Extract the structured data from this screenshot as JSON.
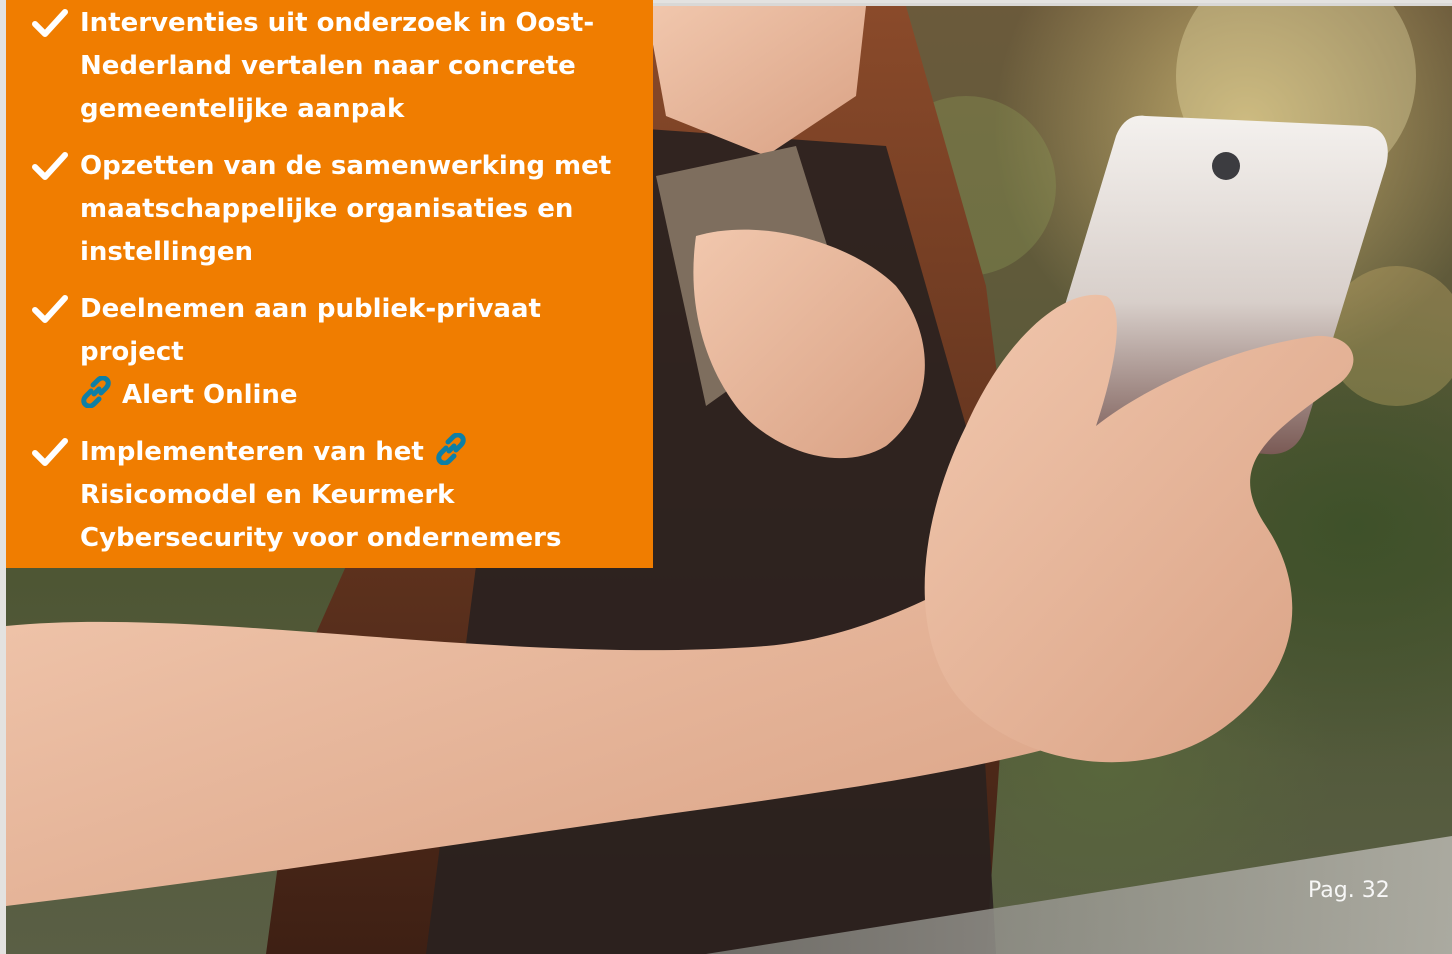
{
  "checklist": {
    "items": [
      {
        "text": "Interventies uit onderzoek in Oost-Nederland vertalen naar concrete gemeentelijke aanpak"
      },
      {
        "text": "Opzetten van de samenwerking met maatschappelijke organisaties en instellingen"
      },
      {
        "line1": "Deelnemen aan publiek-privaat project",
        "link": "Alert Online"
      },
      {
        "prefix": "Implementeren van het",
        "link": "Risicomodel en Keurmerk Cybersecurity voor ondernemers"
      }
    ]
  },
  "footer": {
    "page_number": "Pag. 32"
  },
  "colors": {
    "panel": "#f07d00",
    "link_icon": "#0e7fa5",
    "text": "#ffffff"
  },
  "icons": {
    "check": "checkmark-icon",
    "link": "link-icon"
  }
}
